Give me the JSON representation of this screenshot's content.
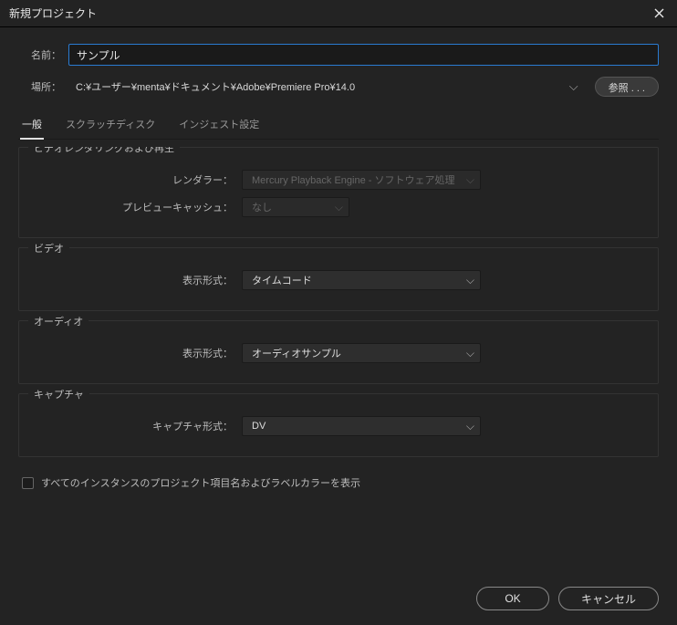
{
  "window": {
    "title": "新規プロジェクト"
  },
  "fields": {
    "name_label": "名前：",
    "name_value": "サンプル",
    "location_label": "場所：",
    "location_value": "C:¥ユーザー¥menta¥ドキュメント¥Adobe¥Premiere Pro¥14.0",
    "browse_label": "参照 . . ."
  },
  "tabs": {
    "general": "一般",
    "scratch": "スクラッチディスク",
    "ingest": "インジェスト設定"
  },
  "groups": {
    "render": {
      "legend": "ビデオレンダリングおよび再生",
      "renderer_label": "レンダラー：",
      "renderer_value": "Mercury Playback Engine - ソフトウェア処理",
      "preview_label": "プレビューキャッシュ：",
      "preview_value": "なし"
    },
    "video": {
      "legend": "ビデオ",
      "format_label": "表示形式：",
      "format_value": "タイムコード"
    },
    "audio": {
      "legend": "オーディオ",
      "format_label": "表示形式：",
      "format_value": "オーディオサンプル"
    },
    "capture": {
      "legend": "キャプチャ",
      "format_label": "キャプチャ形式：",
      "format_value": "DV"
    }
  },
  "checkbox": {
    "show_label_color": "すべてのインスタンスのプロジェクト項目名およびラベルカラーを表示"
  },
  "buttons": {
    "ok": "OK",
    "cancel": "キャンセル"
  }
}
